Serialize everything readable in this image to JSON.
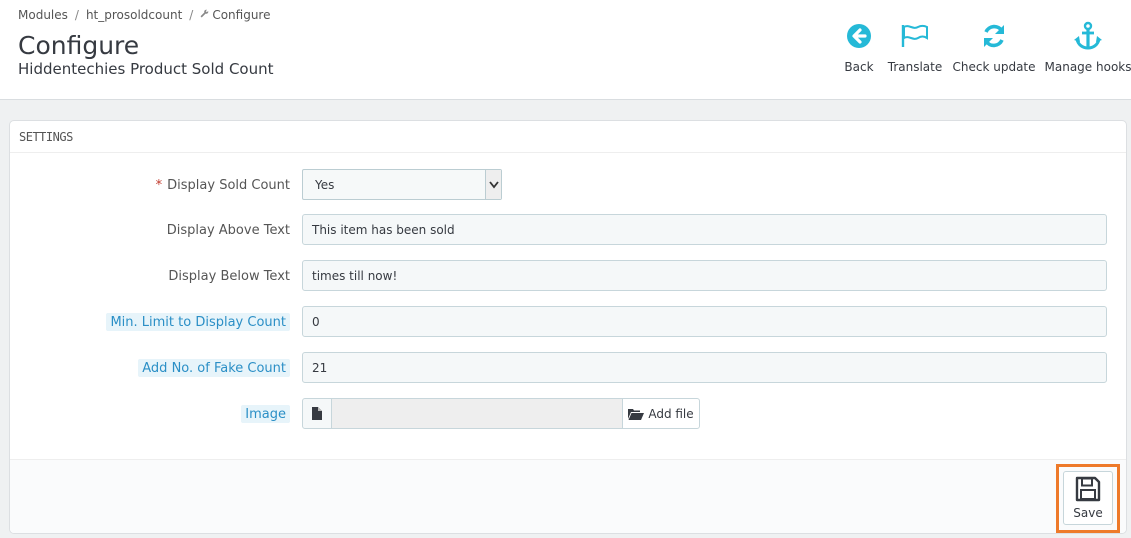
{
  "breadcrumb": {
    "items": [
      "Modules",
      "ht_prosoldcount",
      "Configure"
    ]
  },
  "page": {
    "title": "Configure",
    "subtitle": "Hiddentechies Product Sold Count"
  },
  "toolbar": {
    "back": "Back",
    "translate": "Translate",
    "check_update": "Check update",
    "manage_hooks": "Manage hooks"
  },
  "colors": {
    "accent": "#25b9d7",
    "highlight": "#ee7a2a",
    "required": "#c0392b"
  },
  "panel": {
    "heading": "SETTINGS",
    "fields": {
      "display_sold_count": {
        "label": "Display Sold Count",
        "value": "Yes",
        "required": "*"
      },
      "display_above_text": {
        "label": "Display Above Text",
        "value": "This item has been sold"
      },
      "display_below_text": {
        "label": "Display Below Text",
        "value": "times till now!"
      },
      "min_limit": {
        "label": "Min. Limit to Display Count",
        "value": "0"
      },
      "fake_count": {
        "label": "Add No. of Fake Count",
        "value": "21"
      },
      "image": {
        "label": "Image",
        "button": "Add file"
      }
    },
    "save": "Save"
  }
}
